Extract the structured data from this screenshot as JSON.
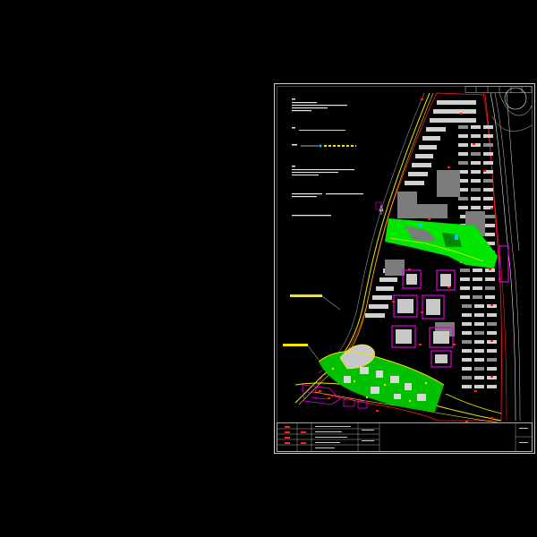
{
  "drawing": {
    "background": "#000000",
    "frame_color": "#cfcfcf",
    "colors": {
      "road": "#f2e600",
      "green_space": "#00e600",
      "buildings_white": "#d8d8d8",
      "buildings_gray": "#8c8c8c",
      "magenta": "#e000e0",
      "red": "#ff2020",
      "cyan": "#00d0e0",
      "notes_white": "#e8e8e8"
    },
    "notes_count": 7,
    "callout_count": 2,
    "title_block": {
      "rows": 5,
      "columns": 6
    },
    "north_arrow_icon": "north-arrow-icon"
  }
}
